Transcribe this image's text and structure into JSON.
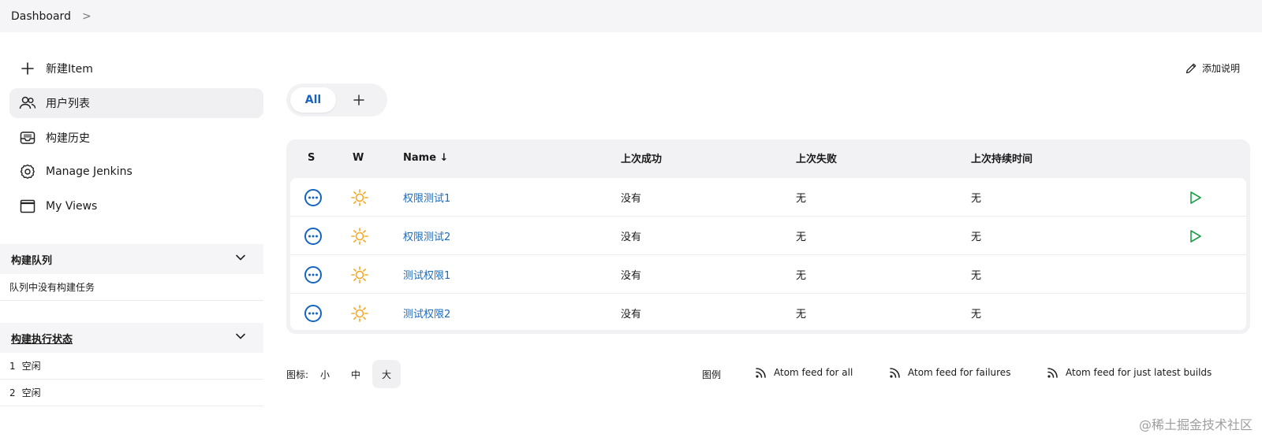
{
  "breadcrumb": {
    "root": "Dashboard",
    "separator": ">"
  },
  "sidebar": {
    "tasks": [
      {
        "label": "新建Item",
        "icon": "plus-icon"
      },
      {
        "label": "用户列表",
        "icon": "users-icon",
        "active": true
      },
      {
        "label": "构建历史",
        "icon": "inbox-icon"
      },
      {
        "label": "Manage Jenkins",
        "icon": "gear-icon"
      },
      {
        "label": "My Views",
        "icon": "window-icon"
      }
    ],
    "build_queue": {
      "title": "构建队列",
      "empty_message": "队列中没有构建任务"
    },
    "executors": {
      "title": "构建执行状态",
      "rows": [
        {
          "index": "1",
          "status": "空闲"
        },
        {
          "index": "2",
          "status": "空闲"
        }
      ]
    }
  },
  "main": {
    "add_description": "添加说明",
    "tabs": {
      "all": "All",
      "add": "+"
    },
    "table": {
      "headers": {
        "s": "S",
        "w": "W",
        "name": "Name ↓",
        "last_success": "上次成功",
        "last_failure": "上次失败",
        "last_duration": "上次持续时间"
      },
      "rows": [
        {
          "name": "权限测试1",
          "last_success": "没有",
          "last_failure": "无",
          "last_duration": "无",
          "can_build": true
        },
        {
          "name": "权限测试2",
          "last_success": "没有",
          "last_failure": "无",
          "last_duration": "无",
          "can_build": true
        },
        {
          "name": "测试权限1",
          "last_success": "没有",
          "last_failure": "无",
          "last_duration": "无",
          "can_build": false
        },
        {
          "name": "测试权限2",
          "last_success": "没有",
          "last_failure": "无",
          "last_duration": "无",
          "can_build": false
        }
      ]
    },
    "footer": {
      "icon_label": "图标:",
      "sizes": [
        "小",
        "中",
        "大"
      ],
      "active_size": "大",
      "legend": "图例",
      "feeds": [
        "Atom feed for all",
        "Atom feed for failures",
        "Atom feed for just latest builds"
      ]
    }
  },
  "watermark": "@稀土掘金技术社区",
  "colors": {
    "link": "#1e6bb8",
    "status_blue": "#1565c0",
    "sun": "#f5a623",
    "play": "#1e9e4a"
  }
}
